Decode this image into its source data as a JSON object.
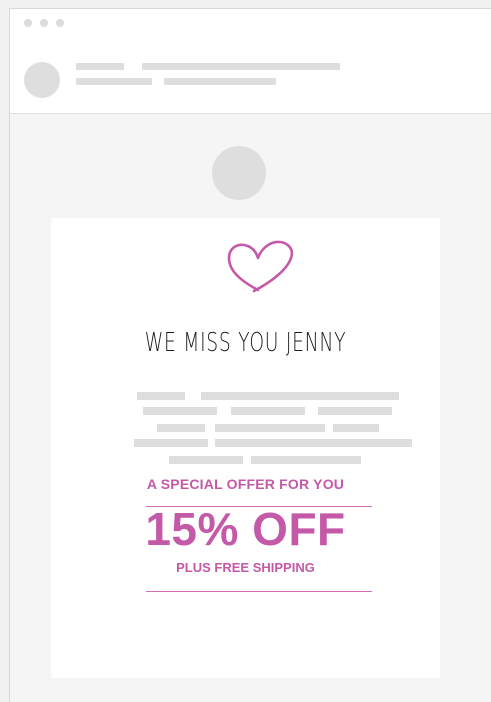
{
  "email": {
    "greeting": "WE MISS YOU JENNY",
    "offer_title": "A SPECIAL OFFER FOR YOU",
    "discount": "15% OFF",
    "shipping": "PLUS FREE SHIPPING"
  },
  "colors": {
    "accent": "#c459a8",
    "placeholder": "#dedede",
    "background": "#f5f5f5"
  },
  "icons": {
    "window_controls": "dot-icons",
    "hero": "heart-icon"
  }
}
